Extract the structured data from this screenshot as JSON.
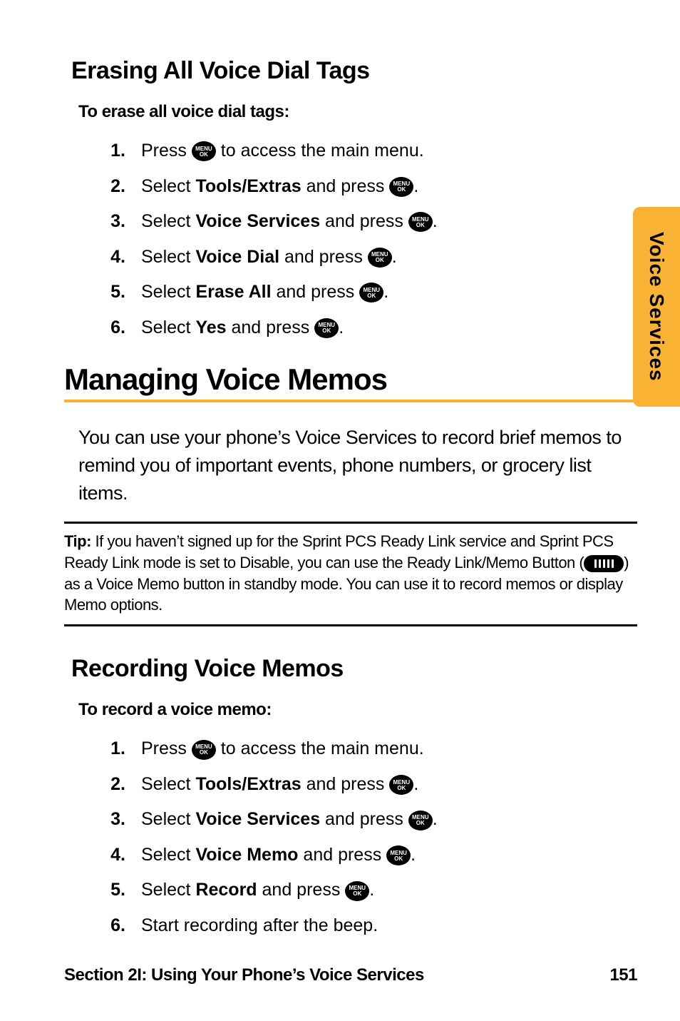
{
  "side_tab": {
    "label": "Voice Services"
  },
  "section_erase": {
    "heading": "Erasing All Voice Dial Tags",
    "lead": "To erase all voice dial tags:",
    "steps": [
      {
        "num": "1.",
        "before": "Press ",
        "bold": "",
        "after": " to access the main menu.",
        "icon": "menu",
        "icon_pos": "mid"
      },
      {
        "num": "2.",
        "before": "Select ",
        "bold": "Tools/Extras",
        "after": " and press ",
        "icon": "menu",
        "icon_pos": "end",
        "tail": "."
      },
      {
        "num": "3.",
        "before": "Select ",
        "bold": "Voice Services",
        "after": " and press ",
        "icon": "menu",
        "icon_pos": "end",
        "tail": "."
      },
      {
        "num": "4.",
        "before": "Select ",
        "bold": "Voice Dial",
        "after": " and press ",
        "icon": "menu",
        "icon_pos": "end",
        "tail": "."
      },
      {
        "num": "5.",
        "before": "Select ",
        "bold": "Erase All",
        "after": " and press ",
        "icon": "menu",
        "icon_pos": "end",
        "tail": "."
      },
      {
        "num": "6.",
        "before": "Select ",
        "bold": "Yes",
        "after": " and press ",
        "icon": "menu",
        "icon_pos": "end",
        "tail": "."
      }
    ]
  },
  "big_heading": "Managing Voice Memos",
  "body_para": "You can use your phone’s Voice Services to record brief memos to remind you of important events, phone numbers, or grocery list items.",
  "tip": {
    "label": "Tip:",
    "text_before": " If you haven’t signed up for the Sprint PCS Ready Link service and Sprint PCS Ready Link mode is set to Disable, you can use the Ready Link/Memo Button (",
    "text_after": ") as a Voice Memo button in standby mode. You can use it to record memos or display Memo options."
  },
  "section_record": {
    "heading": "Recording Voice Memos",
    "lead": "To record a voice memo:",
    "steps": [
      {
        "num": "1.",
        "before": "Press ",
        "bold": "",
        "after": " to access the main menu.",
        "icon": "menu",
        "icon_pos": "mid"
      },
      {
        "num": "2.",
        "before": "Select ",
        "bold": "Tools/Extras",
        "after": " and press ",
        "icon": "menu",
        "icon_pos": "end",
        "tail": "."
      },
      {
        "num": "3.",
        "before": "Select ",
        "bold": "Voice Services",
        "after": " and press ",
        "icon": "menu",
        "icon_pos": "end",
        "tail": "."
      },
      {
        "num": "4.",
        "before": "Select ",
        "bold": "Voice Memo",
        "after": " and press ",
        "icon": "menu",
        "icon_pos": "end",
        "tail": "."
      },
      {
        "num": "5.",
        "before": "Select ",
        "bold": "Record",
        "after": " and press ",
        "icon": "menu",
        "icon_pos": "end",
        "tail": "."
      },
      {
        "num": "6.",
        "before": "Start recording after the beep.",
        "bold": "",
        "after": "",
        "icon": "",
        "icon_pos": ""
      }
    ]
  },
  "footer": {
    "left": "Section 2I: Using Your Phone’s Voice Services",
    "right": "151"
  }
}
